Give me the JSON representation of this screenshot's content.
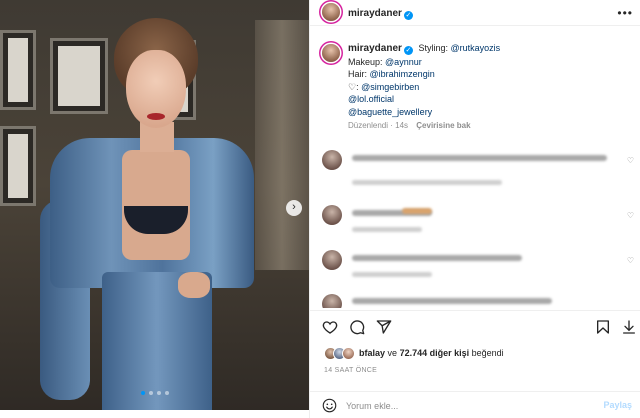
{
  "post": {
    "author": "miraydaner",
    "photo_alt": "",
    "carousel": {
      "slides": 4,
      "active_index": 0
    }
  },
  "caption": {
    "author": "miraydaner",
    "styling_label": "Styling:",
    "styling_handle": "@rutkayozis",
    "makeup_label": "Makeup:",
    "makeup_handle": "@aynnur",
    "hair_label": "Hair:",
    "hair_handle": "@ibrahimzengin",
    "heart_label": ":",
    "heart_handle": "@simgebirben",
    "line5_handle": "@lol.official",
    "line6_handle": "@baguette_jewellery",
    "edited": "Düzenlendi · 14s",
    "see_translation": "Çevirisine bak"
  },
  "actions": {
    "like_icon": "heart-outline",
    "comment_icon": "speech-bubble",
    "share_icon": "paper-plane",
    "save_icon": "bookmark",
    "download_icon": "download-arrow"
  },
  "likes": {
    "first_liker": "bfalay",
    "connector": "ve",
    "others": "72.744 diğer kişi",
    "suffix": "beğendi"
  },
  "timestamp": "14 SAAT ÖNCE",
  "composer": {
    "placeholder": "Yorum ekle...",
    "post_label": "Paylaş"
  },
  "colors": {
    "link": "#00376b",
    "verified": "#0095f6",
    "post_button_disabled": "#b3dbff",
    "muted": "#8e8e8e"
  }
}
